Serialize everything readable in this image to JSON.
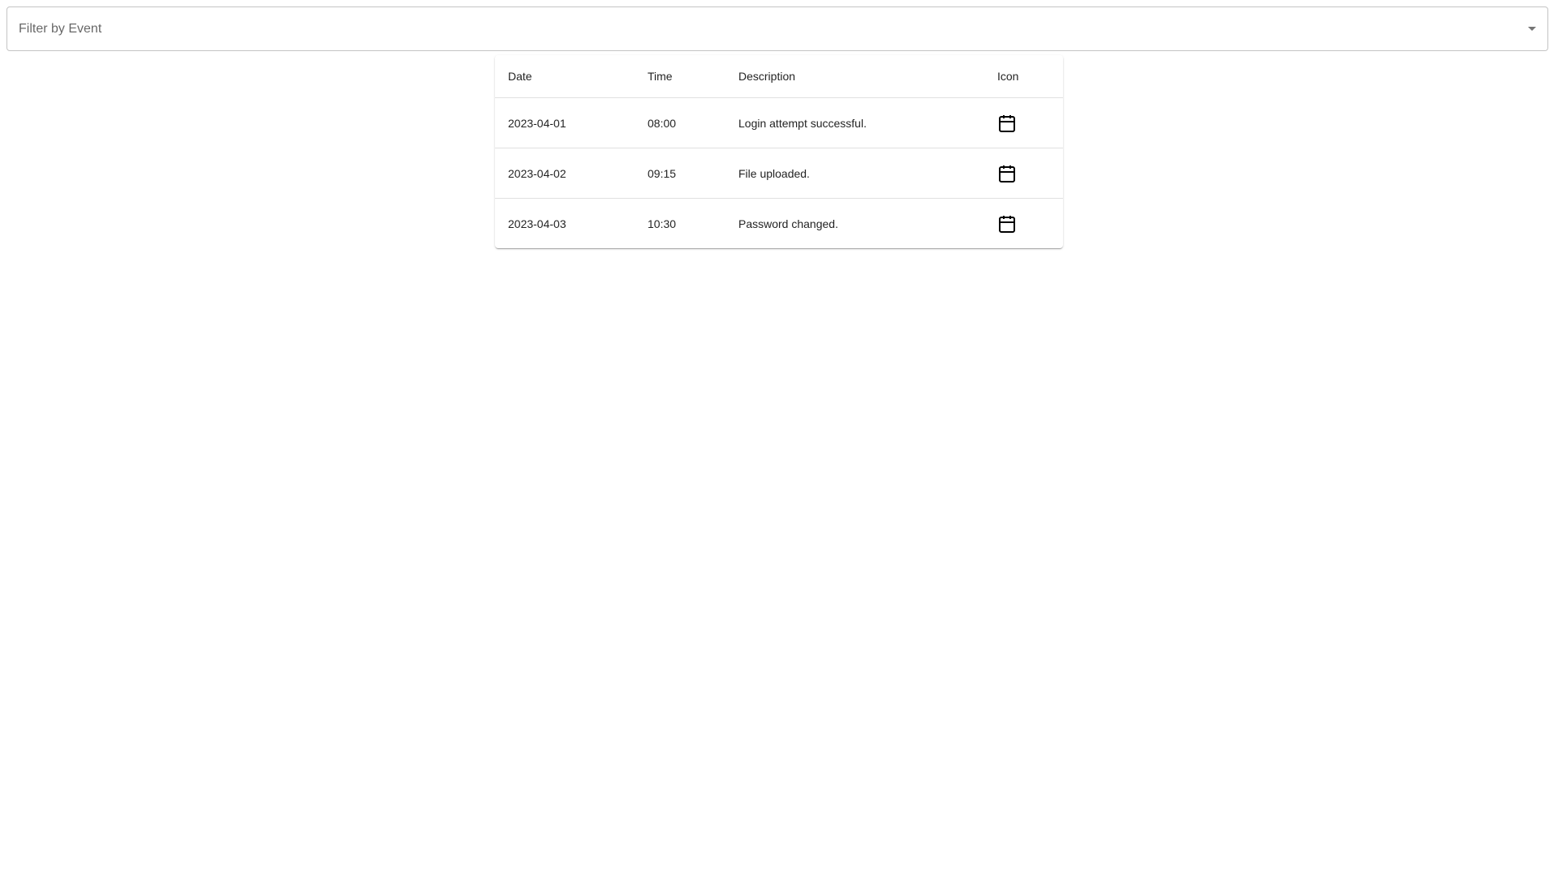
{
  "filter": {
    "placeholder": "Filter by Event"
  },
  "table": {
    "headers": {
      "date": "Date",
      "time": "Time",
      "description": "Description",
      "icon": "Icon"
    },
    "rows": [
      {
        "date": "2023-04-01",
        "time": "08:00",
        "description": "Login attempt successful.",
        "icon": "calendar-icon"
      },
      {
        "date": "2023-04-02",
        "time": "09:15",
        "description": "File uploaded.",
        "icon": "calendar-icon"
      },
      {
        "date": "2023-04-03",
        "time": "10:30",
        "description": "Password changed.",
        "icon": "calendar-icon"
      }
    ]
  }
}
